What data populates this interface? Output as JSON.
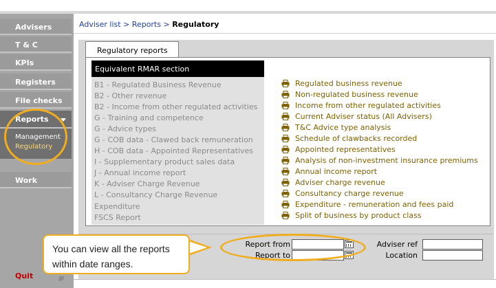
{
  "sidebar": {
    "items": [
      {
        "label": "Advisers"
      },
      {
        "label": "T & C"
      },
      {
        "label": "KPIs"
      },
      {
        "label": "Registers"
      },
      {
        "label": "File checks"
      },
      {
        "label": "Reports"
      },
      {
        "label": "Work"
      }
    ],
    "sub_items": [
      {
        "label": "Management"
      },
      {
        "label": "Regulatory"
      }
    ],
    "quit_label": "Quit",
    "grip": "////"
  },
  "breadcrumb": {
    "items": [
      "Adviser list",
      "Reports",
      "Regulatory"
    ],
    "separator": ">"
  },
  "tab": {
    "label": "Regulatory reports"
  },
  "rmar": {
    "heading": "Equivalent RMAR section",
    "items": [
      "B1 - Regulated Business Revenue",
      "B2 - Other revenue",
      "B2 - Income from other regulated activities",
      "G - Training and competence",
      "G - Advice types",
      "G - COB data - Clawed back remuneration",
      "H - COB data - Appointed Representatives",
      "I - Supplementary product sales data",
      "J - Annual income report",
      "K - Adviser Charge Revenue",
      "L - Consultancy Charge Revenue",
      "Expenditure",
      "FSCS Report"
    ]
  },
  "reports": [
    "Regulated business revenue",
    "Non-regulated business revenue",
    "Income from other regulated activities",
    "Current Adviser status (All Advisers)",
    "T&C Advice type analysis",
    "Schedule of clawbacks recorded",
    "Appointed representatives",
    "Analysis of non-investment insurance premiums",
    "Annual income report",
    "Adviser charge revenue",
    "Consultancy charge revenue",
    "Expenditure - remuneration and fees paid",
    "Split of business by product class"
  ],
  "filters": {
    "report_from_label": "Report from",
    "report_from_value": "",
    "report_to_label": "Report to",
    "report_to_value": "",
    "adviser_ref_label": "Adviser ref",
    "adviser_ref_value": "",
    "location_label": "Location",
    "location_value": ""
  },
  "annotation": {
    "callout_text": "You can view all the reports within date ranges."
  },
  "colors": {
    "highlight": "#f0ad1e",
    "link": "#7f6000",
    "breadcrumb_link": "#1f3f9f",
    "sidebar": "#9b9b9b",
    "quit": "#c00000"
  }
}
